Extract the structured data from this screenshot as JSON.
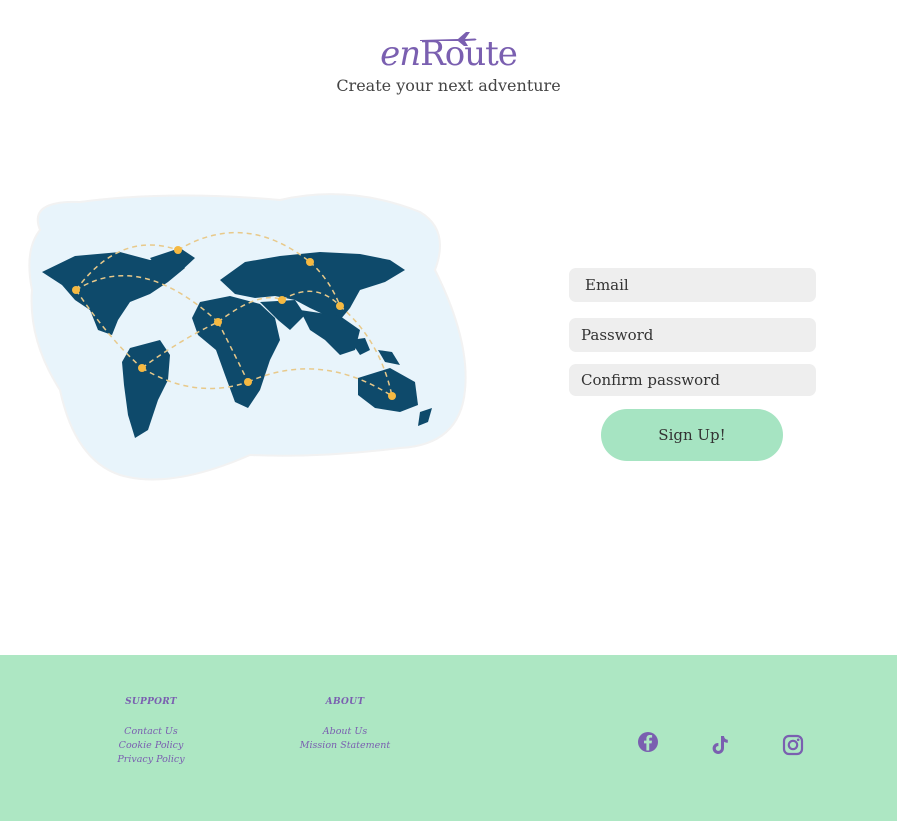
{
  "header": {
    "logo": {
      "prefix": "en",
      "suffix": "Route"
    },
    "tagline": "Create your next adventure"
  },
  "hero": {
    "image_icon": "world-map-illustration",
    "colors": {
      "land": "#0e4a6b",
      "ocean": "#e8f4fb",
      "route": "#e8c98a",
      "dot": "#f5b942"
    }
  },
  "signup_form": {
    "email_placeholder": "Email",
    "password_placeholder": "Password",
    "confirm_placeholder": "Confirm password",
    "submit_label": "Sign Up!"
  },
  "footer": {
    "background": "#ade7c3",
    "accent": "#7a5fb0",
    "support": {
      "heading": "SUPPORT",
      "links": [
        "Contact Us",
        "Cookie Policy",
        "Privacy Policy"
      ]
    },
    "about": {
      "heading": "ABOUT",
      "links": [
        "About Us",
        "Mission Statement"
      ]
    },
    "social": [
      {
        "name": "facebook-icon"
      },
      {
        "name": "tiktok-icon"
      },
      {
        "name": "instagram-icon"
      }
    ]
  }
}
